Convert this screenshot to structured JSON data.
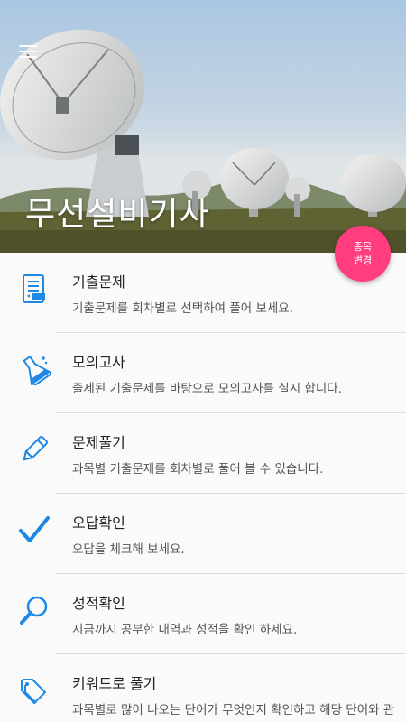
{
  "header": {
    "title": "무선설비기사",
    "menu_icon": "menu-icon",
    "change_button_line1": "종목",
    "change_button_line2": "변경",
    "accent_color": "#ff3d7f"
  },
  "menu": {
    "icon_color": "#1e88e5",
    "items": [
      {
        "title": "기출문제",
        "desc": "기출문제를 회차별로 선택하여 풀어 보세요.",
        "icon": "document-list-icon"
      },
      {
        "title": "모의고사",
        "desc": "출제된 기출문제를 바탕으로 모의고사를 실시 합니다.",
        "icon": "flask-icon"
      },
      {
        "title": "문제풀기",
        "desc": "과목별 기출문제를 회차별로 풀어 볼 수 있습니다.",
        "icon": "pencil-icon"
      },
      {
        "title": "오답확인",
        "desc": "오답을 체크해 보세요.",
        "icon": "checkmark-icon"
      },
      {
        "title": "성적확인",
        "desc": "지금까지 공부한 내역과 성적을 확인 하세요.",
        "icon": "magnifier-icon"
      },
      {
        "title": "키워드로 풀기",
        "desc": "과목별로 많이 나오는 단어가 무엇인지 확인하고 해당 단어와 관련된 문제들을 풀어 보세요.",
        "icon": "tag-icon"
      }
    ]
  }
}
